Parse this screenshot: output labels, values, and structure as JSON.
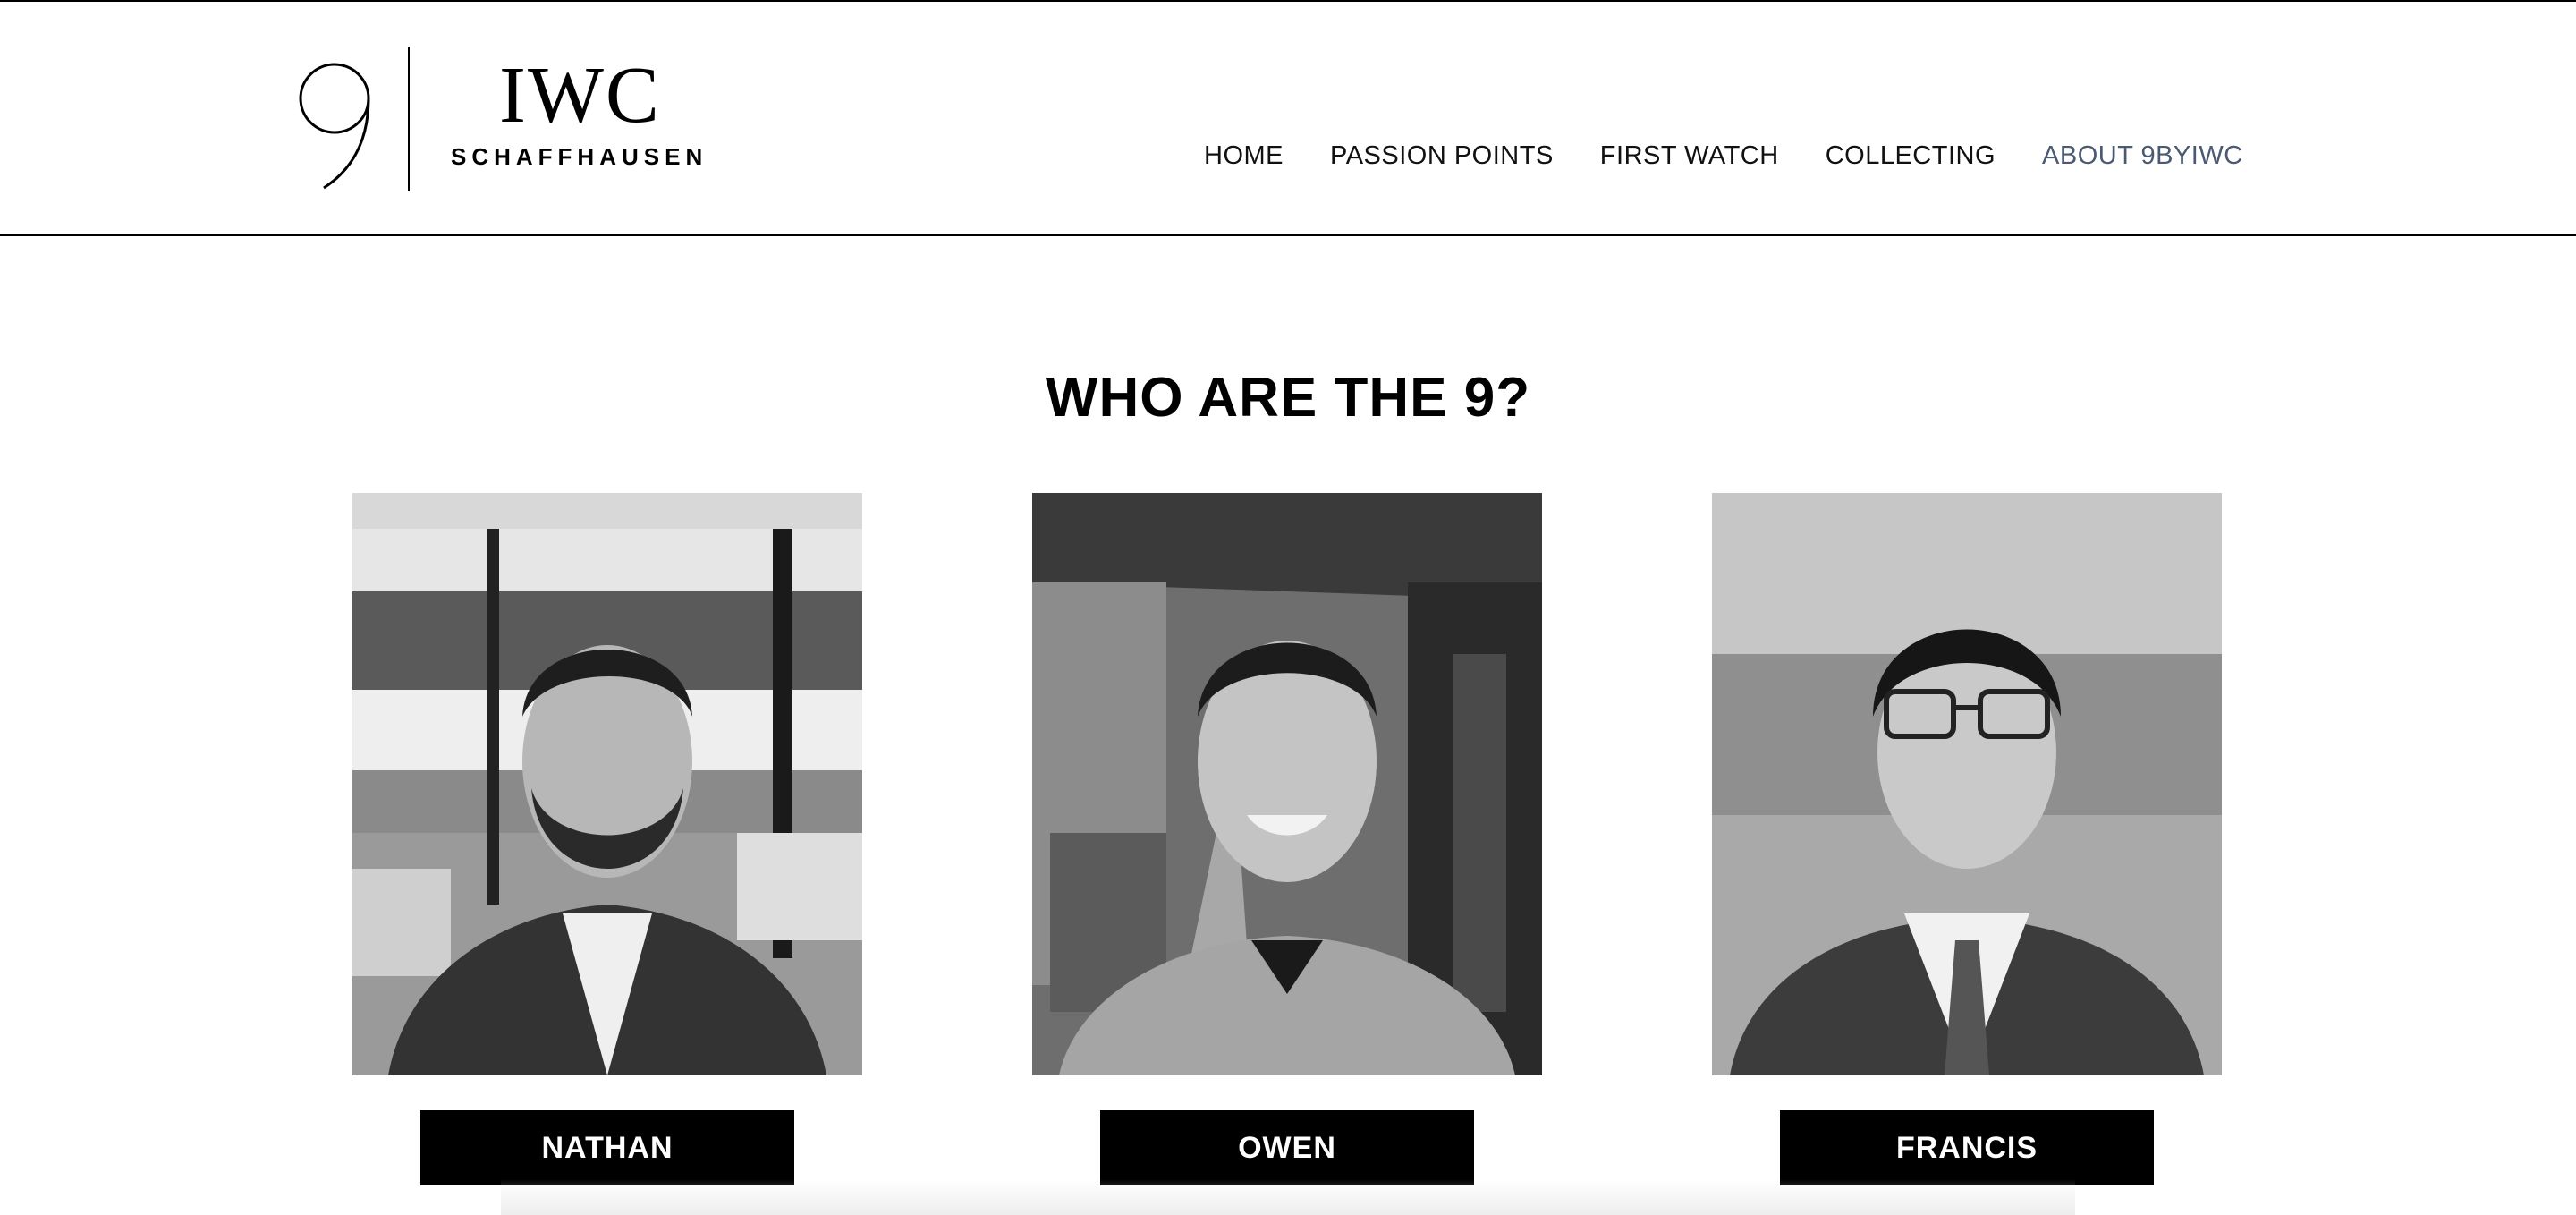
{
  "header": {
    "logo": {
      "mark": "9",
      "brand": "IWC",
      "subtitle": "SCHAFFHAUSEN"
    },
    "nav": [
      {
        "label": "HOME",
        "active": false
      },
      {
        "label": "PASSION POINTS",
        "active": false
      },
      {
        "label": "FIRST WATCH",
        "active": false
      },
      {
        "label": "COLLECTING",
        "active": false
      },
      {
        "label": "ABOUT 9BYIWC",
        "active": true
      }
    ],
    "active_color": "#4a5a72"
  },
  "main": {
    "title": "WHO ARE THE 9?",
    "people": [
      {
        "name": "NATHAN",
        "photo": "portrait-photo"
      },
      {
        "name": "OWEN",
        "photo": "portrait-photo"
      },
      {
        "name": "FRANCIS",
        "photo": "portrait-photo"
      }
    ]
  }
}
